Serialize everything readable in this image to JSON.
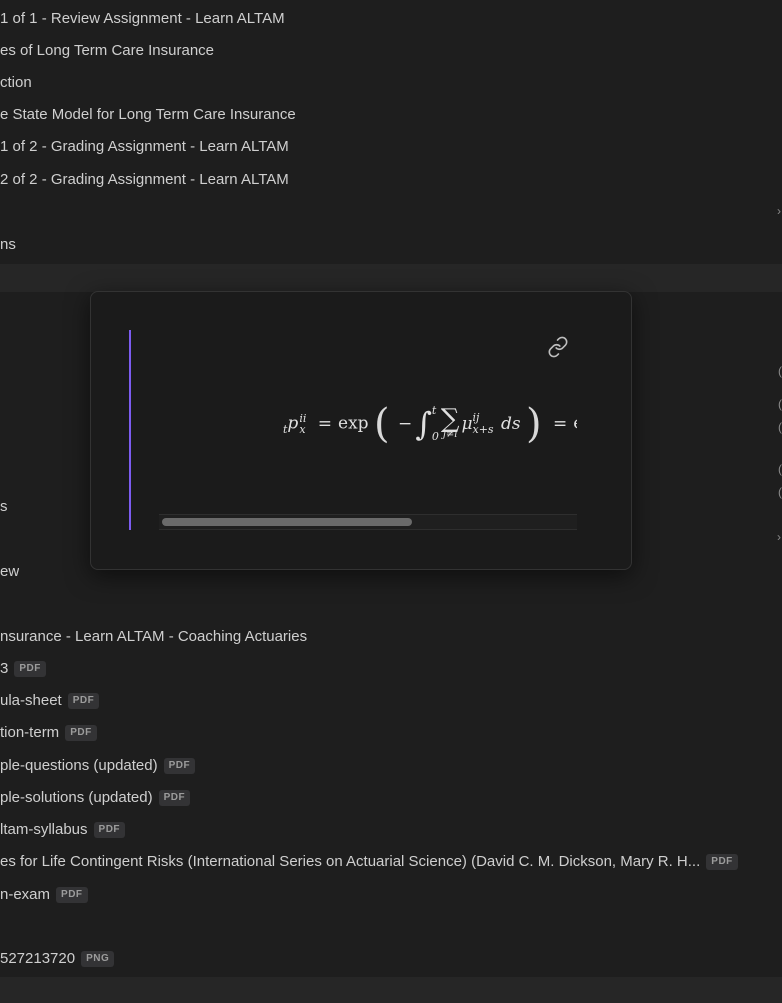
{
  "list_top": [
    {
      "label": "1 of 1 - Review Assignment - Learn ALTAM"
    },
    {
      "label": "es of Long Term Care Insurance"
    },
    {
      "label": "ction"
    },
    {
      "label": "e State Model for Long Term Care Insurance"
    },
    {
      "label": "1 of 2 - Grading Assignment - Learn ALTAM"
    },
    {
      "label": "2 of 2 - Grading Assignment - Learn ALTAM"
    },
    {
      "label": ""
    },
    {
      "label": "ns"
    }
  ],
  "list_mid": [
    {
      "label": "s"
    },
    {
      "label": "ew"
    }
  ],
  "list_bottom": [
    {
      "label": "nsurance - Learn ALTAM - Coaching Actuaries",
      "badge": ""
    },
    {
      "label": "3",
      "badge": "PDF"
    },
    {
      "label": "ula-sheet",
      "badge": "PDF"
    },
    {
      "label": "tion-term",
      "badge": "PDF"
    },
    {
      "label": "ple-questions (updated)",
      "badge": "PDF"
    },
    {
      "label": "ple-solutions (updated)",
      "badge": "PDF"
    },
    {
      "label": "ltam-syllabus",
      "badge": "PDF"
    },
    {
      "label": "es for Life Contingent Risks (International Series on Actuarial Science) (David C. M. Dickson, Mary R. H...",
      "badge": "PDF"
    },
    {
      "label": "n-exam",
      "badge": "PDF"
    },
    {
      "label": "",
      "badge": ""
    },
    {
      "label": "527213720",
      "badge": "PNG"
    }
  ],
  "popover": {
    "icon": "link-icon",
    "formula": {
      "lhs_pre": "t",
      "lhs_p": "p",
      "lhs_sup": "ii",
      "lhs_sub": "x",
      "eq1": "=",
      "fn": "exp",
      "minus": "−",
      "int_upper": "t",
      "int_lower": "0",
      "sum_lower": "j≠i",
      "mu": "μ",
      "mu_sup": "ij",
      "mu_sub": "x+s",
      "ds": "ds",
      "eq2": "=",
      "tail": "ex"
    },
    "accent_color": "#7c5cf0"
  }
}
